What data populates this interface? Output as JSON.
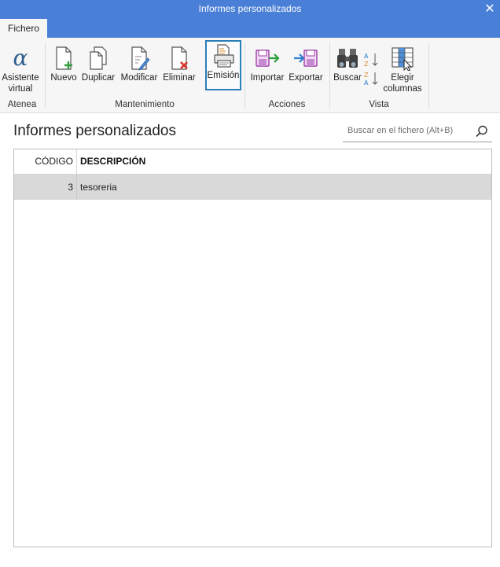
{
  "window": {
    "title": "Informes personalizados",
    "close_glyph": "✕"
  },
  "tabs": [
    {
      "label": "Fichero",
      "active": true
    }
  ],
  "ribbon": {
    "groups": {
      "atenea": "Atenea",
      "mantenimiento": "Mantenimiento",
      "acciones": "Acciones",
      "vista": "Vista"
    },
    "buttons": {
      "asistente": {
        "label": "Asistente virtual",
        "icon": "alpha-assistant-icon"
      },
      "nuevo": {
        "label": "Nuevo",
        "icon": "new-document-icon"
      },
      "duplicar": {
        "label": "Duplicar",
        "icon": "duplicate-icon"
      },
      "modificar": {
        "label": "Modificar",
        "icon": "edit-document-icon"
      },
      "eliminar": {
        "label": "Eliminar",
        "icon": "delete-document-icon"
      },
      "emision": {
        "label": "Emisión",
        "icon": "print-icon",
        "selected": true
      },
      "importar": {
        "label": "Importar",
        "icon": "import-icon"
      },
      "exportar": {
        "label": "Exportar",
        "icon": "export-icon"
      },
      "buscar": {
        "label": "Buscar",
        "icon": "binoculars-icon"
      },
      "elegir": {
        "label": "Elegir columnas",
        "icon": "choose-columns-icon"
      }
    },
    "sort": {
      "asc_icon": "sort-az-icon",
      "desc_icon": "sort-za-icon"
    }
  },
  "main": {
    "title": "Informes personalizados",
    "search": {
      "placeholder": "Buscar en el fichero (Alt+B)",
      "value": ""
    }
  },
  "table": {
    "columns": [
      "CÓDIGO",
      "DESCRIPCIÓN"
    ],
    "rows": [
      {
        "codigo": "3",
        "descripcion": "tesoreria",
        "selected": true
      }
    ]
  },
  "colors": {
    "titlebar": "#4a7fd8",
    "ribbon_bg": "#f6f6f6",
    "selected_button_border": "#2b7fb8",
    "selected_row": "#d9d9d9",
    "icon_green": "#2e9e3e",
    "icon_red": "#d9342b",
    "icon_purple": "#9b3fa5",
    "icon_blue": "#2b7fd0"
  }
}
